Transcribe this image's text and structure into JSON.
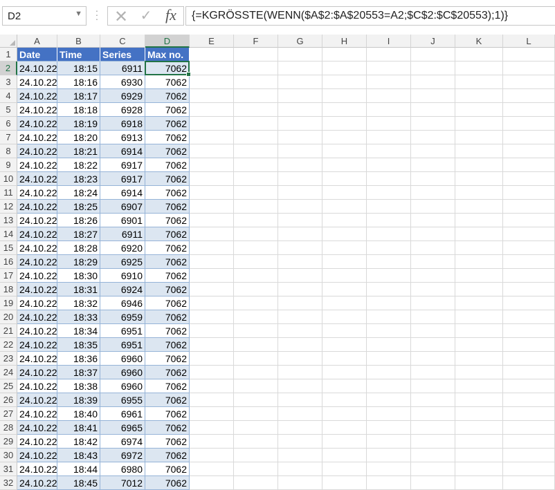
{
  "formula_bar": {
    "name_box": "D2",
    "cancel_icon": "close-icon",
    "enter_icon": "check-icon",
    "fx_label": "fx",
    "formula": "{=KGRÖSSTE(WENN($A$2:$A$20553=A2;$C$2:$C$20553);1)}"
  },
  "columns": [
    "A",
    "B",
    "C",
    "D",
    "E",
    "F",
    "G",
    "H",
    "I",
    "J",
    "K",
    "L"
  ],
  "selected_cell": "D2",
  "table": {
    "headers": [
      "Date",
      "Time",
      "Series",
      "Max no."
    ],
    "rows": [
      [
        "24.10.22",
        "18:15",
        "6911",
        "7062"
      ],
      [
        "24.10.22",
        "18:16",
        "6930",
        "7062"
      ],
      [
        "24.10.22",
        "18:17",
        "6929",
        "7062"
      ],
      [
        "24.10.22",
        "18:18",
        "6928",
        "7062"
      ],
      [
        "24.10.22",
        "18:19",
        "6918",
        "7062"
      ],
      [
        "24.10.22",
        "18:20",
        "6913",
        "7062"
      ],
      [
        "24.10.22",
        "18:21",
        "6914",
        "7062"
      ],
      [
        "24.10.22",
        "18:22",
        "6917",
        "7062"
      ],
      [
        "24.10.22",
        "18:23",
        "6917",
        "7062"
      ],
      [
        "24.10.22",
        "18:24",
        "6914",
        "7062"
      ],
      [
        "24.10.22",
        "18:25",
        "6907",
        "7062"
      ],
      [
        "24.10.22",
        "18:26",
        "6901",
        "7062"
      ],
      [
        "24.10.22",
        "18:27",
        "6911",
        "7062"
      ],
      [
        "24.10.22",
        "18:28",
        "6920",
        "7062"
      ],
      [
        "24.10.22",
        "18:29",
        "6925",
        "7062"
      ],
      [
        "24.10.22",
        "18:30",
        "6910",
        "7062"
      ],
      [
        "24.10.22",
        "18:31",
        "6924",
        "7062"
      ],
      [
        "24.10.22",
        "18:32",
        "6946",
        "7062"
      ],
      [
        "24.10.22",
        "18:33",
        "6959",
        "7062"
      ],
      [
        "24.10.22",
        "18:34",
        "6951",
        "7062"
      ],
      [
        "24.10.22",
        "18:35",
        "6951",
        "7062"
      ],
      [
        "24.10.22",
        "18:36",
        "6960",
        "7062"
      ],
      [
        "24.10.22",
        "18:37",
        "6960",
        "7062"
      ],
      [
        "24.10.22",
        "18:38",
        "6960",
        "7062"
      ],
      [
        "24.10.22",
        "18:39",
        "6955",
        "7062"
      ],
      [
        "24.10.22",
        "18:40",
        "6961",
        "7062"
      ],
      [
        "24.10.22",
        "18:41",
        "6965",
        "7062"
      ],
      [
        "24.10.22",
        "18:42",
        "6974",
        "7062"
      ],
      [
        "24.10.22",
        "18:43",
        "6972",
        "7062"
      ],
      [
        "24.10.22",
        "18:44",
        "6980",
        "7062"
      ],
      [
        "24.10.22",
        "18:45",
        "7012",
        "7062"
      ]
    ]
  },
  "colors": {
    "table_header": "#4472c4",
    "table_band": "#dce6f1",
    "selection": "#217346"
  }
}
